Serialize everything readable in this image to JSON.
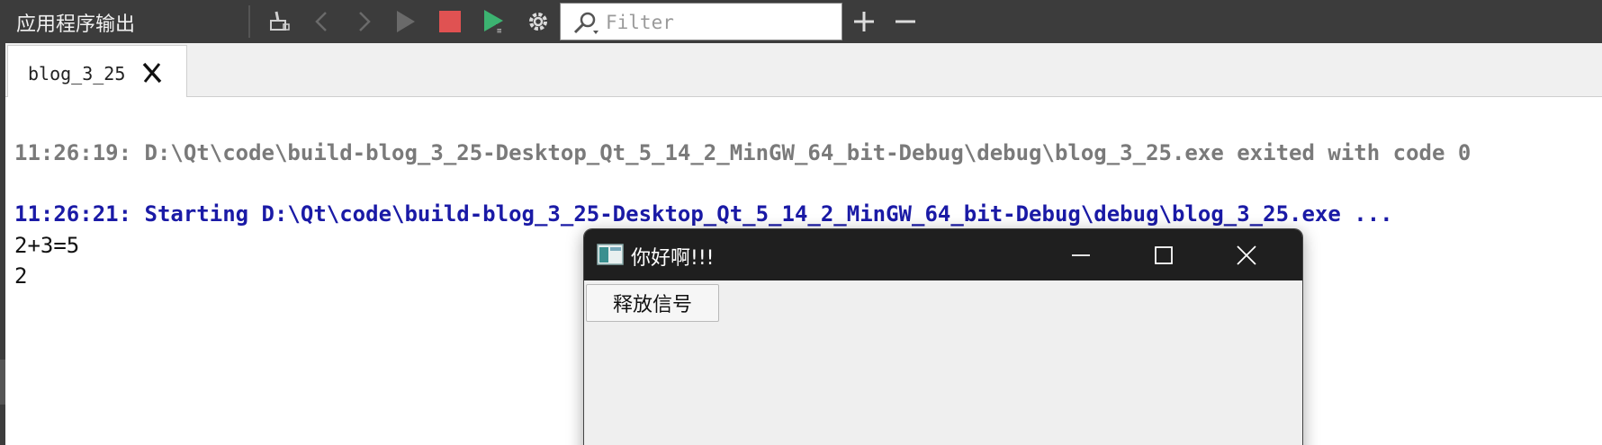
{
  "panel": {
    "title": "应用程序输出"
  },
  "toolbar": {
    "icons": [
      "clear-icon",
      "prev-icon",
      "next-icon",
      "run-icon",
      "stop-icon",
      "debug-run-icon",
      "settings-icon",
      "zoom-in-icon",
      "zoom-out-icon"
    ],
    "filter_placeholder": "Filter",
    "filter_value": ""
  },
  "tabs": [
    {
      "label": "blog_3_25",
      "active": true
    }
  ],
  "output": {
    "lines": [
      {
        "text": "11:26:19: D:\\Qt\\code\\build-blog_3_25-Desktop_Qt_5_14_2_MinGW_64_bit-Debug\\debug\\blog_3_25.exe exited with code 0",
        "style": "gray"
      },
      {
        "text": "11:26:21: Starting D:\\Qt\\code\\build-blog_3_25-Desktop_Qt_5_14_2_MinGW_64_bit-Debug\\debug\\blog_3_25.exe ...",
        "style": "blue"
      },
      {
        "text": "2+3=5",
        "style": "plain"
      },
      {
        "text": "2",
        "style": "plain"
      }
    ]
  },
  "app_window": {
    "title": "你好啊!!!",
    "button_label": "释放信号"
  },
  "colors": {
    "toolbar_bg": "#3c3c3c",
    "stop_red": "#e05252",
    "run_green": "#3cb371",
    "message_blue": "#1a1aa6",
    "message_gray": "#7a7a7a"
  }
}
